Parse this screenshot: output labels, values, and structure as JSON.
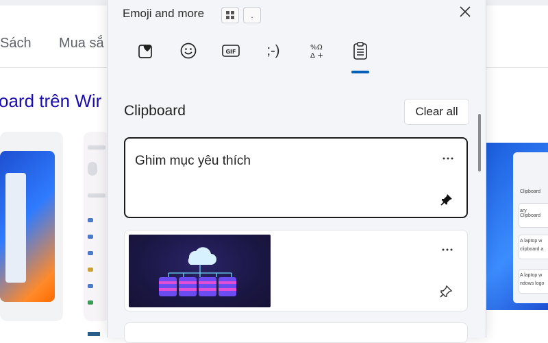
{
  "background_page": {
    "tabs": [
      "Sách",
      "Mua sắ"
    ],
    "title": "oard trên Wir",
    "thumb3_texts": [
      "Clipboard",
      "ary Clipboard",
      "A laptop w",
      "clipboard a",
      "A laptop w",
      "ndows logo"
    ]
  },
  "emoji_panel": {
    "title": "Emoji and more",
    "shortcut_keys": [
      "⊞",
      "."
    ],
    "tabs": [
      {
        "icon": "heart-stack-icon",
        "label": "Most used"
      },
      {
        "icon": "emoji-icon",
        "label": "Emoji"
      },
      {
        "icon": "gif-icon",
        "label": "GIF"
      },
      {
        "icon": "kaomoji-icon",
        "label": ";-)"
      },
      {
        "icon": "symbols-icon",
        "label": "Symbols"
      },
      {
        "icon": "clipboard-icon",
        "label": "Clipboard"
      }
    ],
    "selected_tab": "Clipboard",
    "section_title": "Clipboard",
    "clear_all_label": "Clear all",
    "items": [
      {
        "type": "text",
        "text": "Ghim mục yêu thích",
        "pinned": true
      },
      {
        "type": "image",
        "pinned": false
      }
    ]
  },
  "colors": {
    "accent": "#005fb8",
    "panel_bg": "#f4f5f8",
    "link": "#1a0dab"
  }
}
